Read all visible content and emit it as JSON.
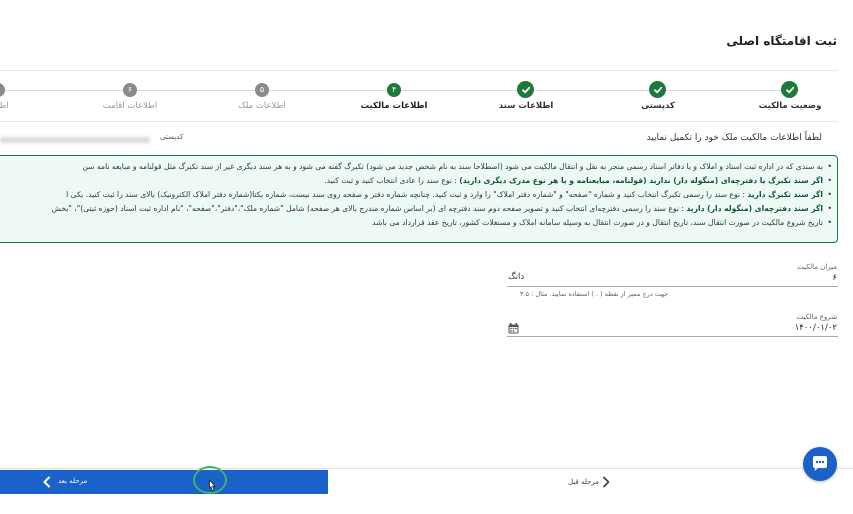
{
  "page": {
    "title": "ثبت اقامتگاه اصلی"
  },
  "stepper": {
    "steps": [
      {
        "label": "وضعیت مالکیت",
        "state": "done",
        "number": ""
      },
      {
        "label": "کدپستی",
        "state": "done",
        "number": ""
      },
      {
        "label": "اطلاعات سند",
        "state": "done",
        "number": ""
      },
      {
        "label": "اطلاعات مالکیت",
        "state": "active",
        "number": "۴"
      },
      {
        "label": "اطلاعات ملک",
        "state": "todo",
        "number": "۵"
      },
      {
        "label": "اطلاعات اقامت",
        "state": "todo",
        "number": "۶"
      },
      {
        "label": "اطلاعا",
        "state": "todo",
        "number": ""
      }
    ]
  },
  "property": {
    "postal_code_label": "کدپستی",
    "prompt": "لطفاً اطلاعات مالکیت ملک خود را تکمیل نمایید"
  },
  "info_box": {
    "items": [
      {
        "bold": "",
        "text": "به سندی که در اداره ثبت اسناد و املاک و یا دفاتر اسناد رسمی منجر به نقل و انتقال مالکیت می شود (اصطلاحا سند به نام شخص جدید می شود) تکبرگ گفته می شود و به هر سند دیگری غیر از سند تکبرگ مثل قولنامه و مبایعه نامه سن"
      },
      {
        "bold": "اگر سند تکبرگ یا دفترچه‌ای (منگوله دار) ندارید (قولنامه، مبایعنامه و یا هر نوع مدرک دیگری دارید)",
        "text": " : نوع سند را عادی انتخاب کنید و ثبت کنید."
      },
      {
        "bold": "اگر سند تکبرگ دارید",
        "text": " : نوع سند را رسمی تکبرگ انتخاب کنید و شماره \"صفحه\" و \"شماره دفتر املاک\" را وارد و ثبت کنید. چنانچه شماره دفتر و صفحه روی سند نیست، شماره یکتا(شماره دفتر املاک الکترونیک) بالای سند را ثبت کنید. یکی ا"
      },
      {
        "bold": "اگر سند دفترچه‌ای (منگوله دار) دارید",
        "text": " : نوع سند را رسمی دفترچه‌ای انتخاب کنید و تصویر صفحه دوم سند دفترچه ای (بر اساس شماره مندرج بالای هر صفحه) شامل \"شماره ملک\"،\"دفتر\"،\"صفحه\"، \"نام اداره ثبت اسناد (حوزه ثبتی)\"، \"بخش"
      },
      {
        "bold": "",
        "text": "تاریخ شروع مالکیت در صورت انتقال سند، تاریخ انتقال و در صورت انتقال به وسیله سامانه املاک و مستغلات کشور، تاریخ عقد قرارداد می باشد"
      }
    ]
  },
  "form": {
    "ownership_amount": {
      "label": "میزان مالکیت",
      "value": "۶",
      "unit": "دانگ",
      "hint": "جهت درج ممیز از نقطه ( . ) استفاده نمایید. مثال : ۳.۵"
    },
    "ownership_start": {
      "label": "شروع مالکیت",
      "value": "۱۴۰۰/۰۱/۰۲",
      "icon": "calendar-icon"
    }
  },
  "footer": {
    "next_label": "مرحله بعد",
    "prev_label": "مرحله قبل",
    "next_color": "#1a62c8"
  },
  "colors": {
    "accent_green": "#1f7a3a",
    "info_bg": "#eef8f4",
    "primary_blue": "#1a62c8"
  }
}
